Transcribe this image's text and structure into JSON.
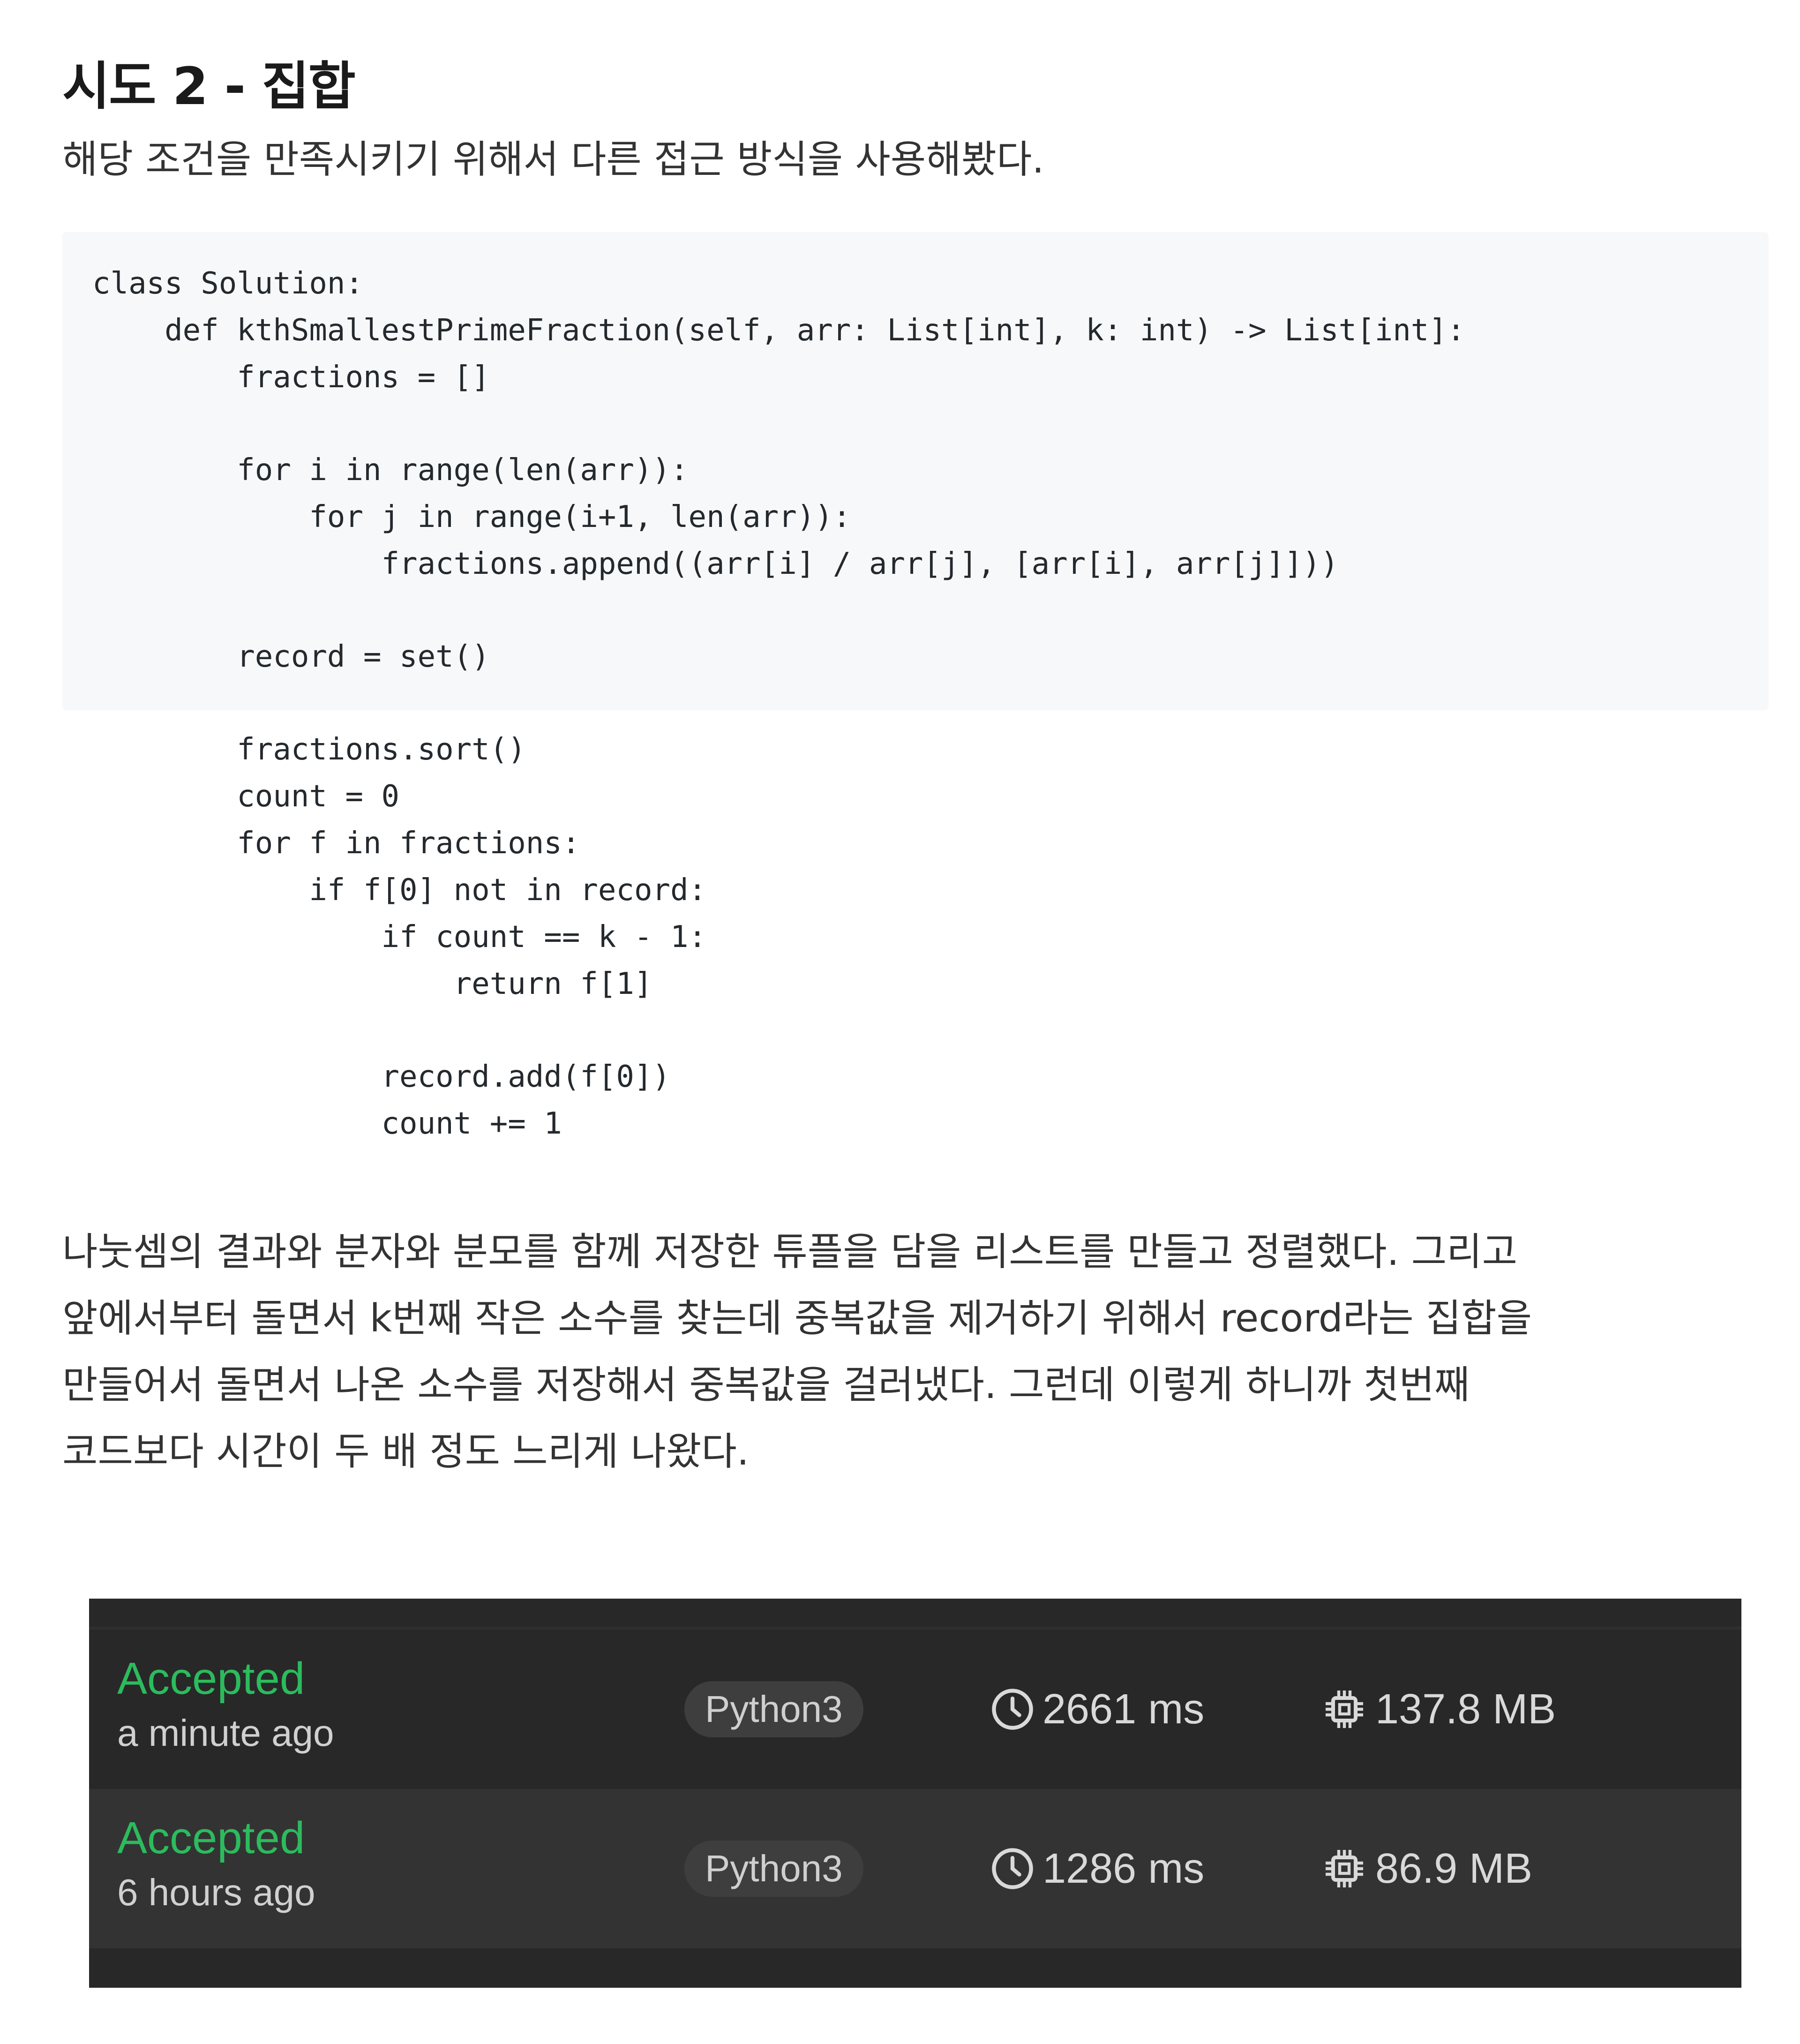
{
  "heading": "시도 2 - 집합",
  "intro": "해당 조건을 만족시키기 위해서 다른 접근 방식을 사용해봤다.",
  "code": {
    "language": "python",
    "lines": [
      "class Solution:",
      "    def kthSmallestPrimeFraction(self, arr: List[int], k: int) -> List[int]:",
      "        fractions = []",
      "",
      "        for i in range(len(arr)):",
      "            for j in range(i+1, len(arr)):",
      "                fractions.append((arr[i] / arr[j], [arr[i], arr[j]]))",
      "",
      "        record = set()",
      "",
      "        fractions.sort()",
      "        count = 0",
      "        for f in fractions:",
      "            if f[0] not in record:",
      "                if count == k - 1:",
      "                    return f[1]",
      "",
      "                record.add(f[0])",
      "                count += 1"
    ]
  },
  "explanation": [
    "나눗셈의 결과와 분자와 분모를 함께 저장한 튜플을 담을 리스트를 만들고 정렬했다. 그리고",
    "앞에서부터 돌면서 k번째 작은 소수를 찾는데 중복값을 제거하기 위해서 record라는 집합을",
    "만들어서 돌면서 나온 소수를 저장해서 중복값을 걸러냈다. 그런데 이렇게 하니까 첫번째",
    "코드보다 시간이 두 배 정도 느리게 나왔다."
  ],
  "submissions": {
    "accent_color": "#2cbb5d",
    "rows": [
      {
        "status": "Accepted",
        "time_ago": "a minute ago",
        "language": "Python3",
        "runtime": "2661 ms",
        "memory": "137.8 MB",
        "runtime_icon": "clock-icon",
        "memory_icon": "chip-icon"
      },
      {
        "status": "Accepted",
        "time_ago": "6 hours ago",
        "language": "Python3",
        "runtime": "1286 ms",
        "memory": "86.9 MB",
        "runtime_icon": "clock-icon",
        "memory_icon": "chip-icon"
      }
    ]
  }
}
